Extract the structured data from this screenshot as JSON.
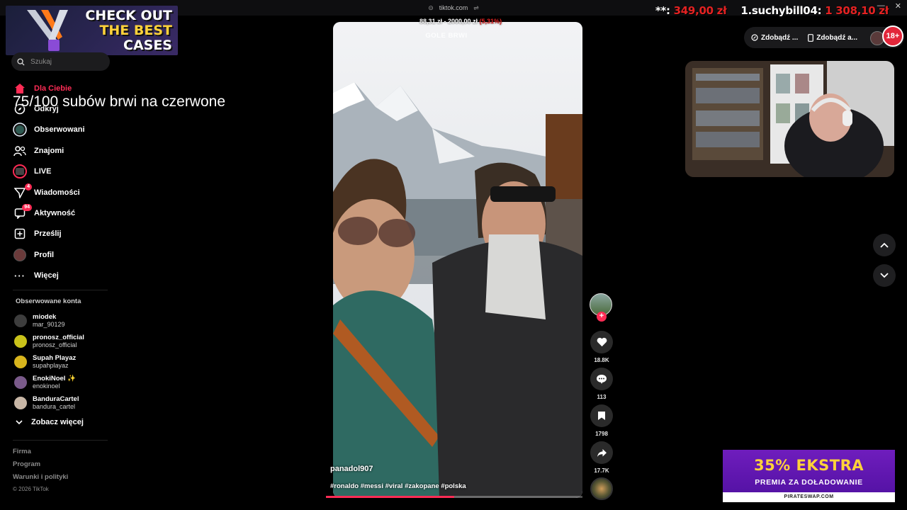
{
  "browser": {
    "url": "tiktok.com"
  },
  "overlays": {
    "promo_line1": "CHECK OUT",
    "promo_line2": "THE BEST",
    "promo_line3": "CASES",
    "donation_user_left": "**:",
    "donation_amount_left": "349,00 zł",
    "donation_user_right": "1.suchybill04:",
    "donation_amount_right": "1 308,10 zł",
    "goal_text": "75/100 subów brwi na czerwone",
    "video_goal_left": "88,31 zł",
    "video_goal_mid": "2000,00 zł",
    "video_goal_pct": "(5,31%)",
    "video_goal_title": "GOLE BRWI",
    "ad_big": "35% EKSTRA",
    "ad_small": "PREMIA ZA DOŁADOWANIE",
    "ad_site": "PIRATESWAP.COM",
    "age_badge": "18+"
  },
  "search": {
    "placeholder": "Szukaj"
  },
  "nav": [
    {
      "label": "Dla Ciebie",
      "icon": "home-icon",
      "active": true
    },
    {
      "label": "Odkryj",
      "icon": "compass-icon"
    },
    {
      "label": "Obserwowani",
      "icon": "following-avatar-icon"
    },
    {
      "label": "Znajomi",
      "icon": "friends-icon"
    },
    {
      "label": "LIVE",
      "icon": "live-icon"
    },
    {
      "label": "Wiadomości",
      "icon": "messages-icon",
      "badge": "4"
    },
    {
      "label": "Aktywność",
      "icon": "activity-icon",
      "badge": "94"
    },
    {
      "label": "Prześlij",
      "icon": "upload-icon"
    },
    {
      "label": "Profil",
      "icon": "profile-icon"
    },
    {
      "label": "Więcej",
      "icon": "more-icon"
    }
  ],
  "followed": {
    "title": "Obserwowane konta",
    "accounts": [
      {
        "name": "miodek",
        "user": "mar_90129",
        "color": "#3d3d3d"
      },
      {
        "name": "pronosz_official",
        "user": "pronosz_official",
        "color": "#c9c21a"
      },
      {
        "name": "Supah Playaz",
        "user": "supahplayaz",
        "color": "#d8b51d"
      },
      {
        "name": "EnokiNoel ✨",
        "user": "enokinoel",
        "color": "#7a5a8a"
      },
      {
        "name": "BanduraCartel",
        "user": "bandura_cartel",
        "color": "#c8b7a6"
      }
    ],
    "see_more": "Zobacz więcej"
  },
  "footer": {
    "firma": "Firma",
    "program": "Program",
    "terms": "Warunki i polityki",
    "copyright": "© 2026 TikTok"
  },
  "video": {
    "author": "panadol907",
    "tags": "#ronaldo #messi #viral #zakopane #polska",
    "progress": 0.5
  },
  "actions": {
    "likes": "18.8K",
    "comments": "113",
    "saves": "1798",
    "shares": "17.7K"
  },
  "topright": {
    "coins_label": "Zdobądź ...",
    "app_label": "Zdobądź a..."
  },
  "colors": {
    "accent": "#fe2c55",
    "donation_red": "#e32222",
    "promo_yellow": "#ffd23a",
    "ad_purple": "#6f1dbd"
  }
}
